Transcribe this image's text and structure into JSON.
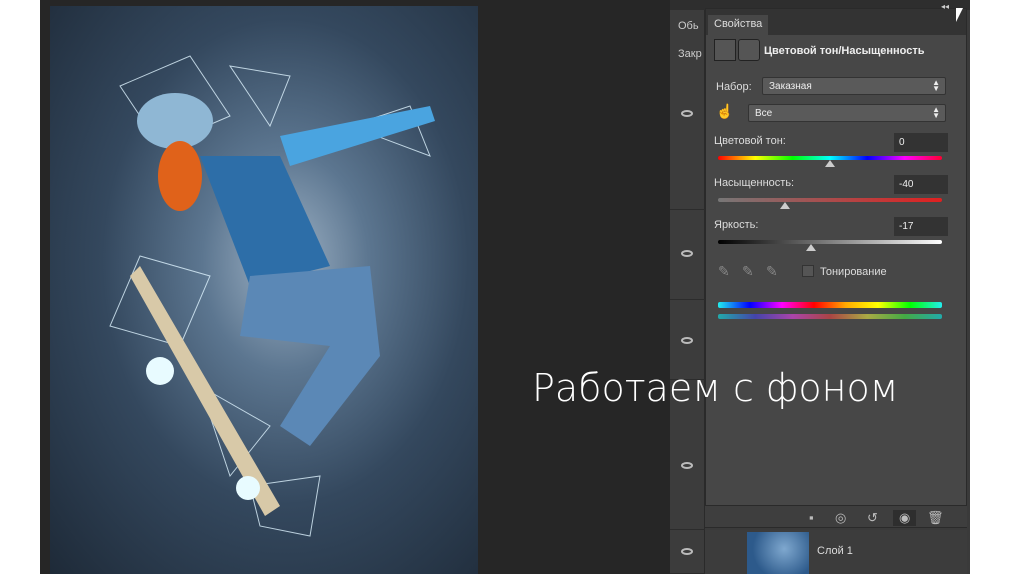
{
  "slide": {
    "caption": "Работаем с фоном"
  },
  "layers_panel": {
    "tab_partial": "Обь",
    "lock_partial": "Закр",
    "layer_name": "Слой 1"
  },
  "properties": {
    "tab": "Свойства",
    "title": "Цветовой тон/Насыщенность",
    "preset_label": "Набор:",
    "preset_value": "Заказная",
    "channel_value": "Все",
    "hue": {
      "label": "Цветовой тон:",
      "value": "0"
    },
    "saturation": {
      "label": "Насыщенность:",
      "value": "-40"
    },
    "lightness": {
      "label": "Яркость:",
      "value": "-17"
    },
    "colorize_label": "Тонирование",
    "colorize_checked": false
  },
  "slider_positions": {
    "hue": 0,
    "saturation": -40,
    "lightness": -17
  }
}
